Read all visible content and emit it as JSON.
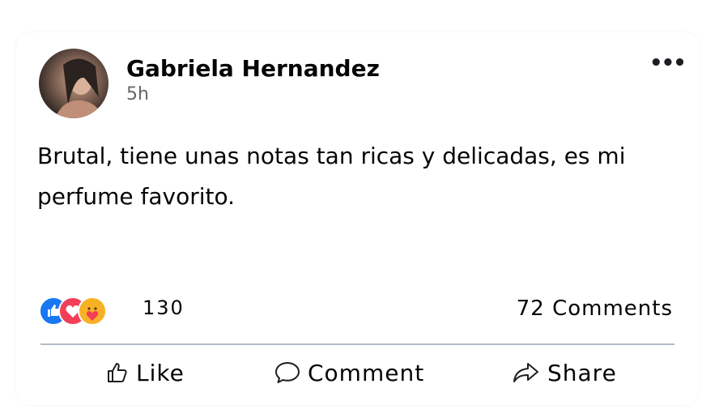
{
  "post": {
    "author": "Gabriela Hernandez",
    "time": "5h",
    "text": "Brutal, tiene unas notas tan ricas y delicadas, es mi perfume favorito.",
    "more_icon": "more-horizontal-icon"
  },
  "reactions": {
    "icons": [
      "like-reaction-icon",
      "love-reaction-icon",
      "care-reaction-icon"
    ],
    "count": "130",
    "colors": {
      "like": "#1877f2",
      "love": "#f33e58",
      "care": "#f7b125"
    }
  },
  "comments": {
    "label": "72 Comments"
  },
  "actions": {
    "like": "Like",
    "comment": "Comment",
    "share": "Share"
  }
}
